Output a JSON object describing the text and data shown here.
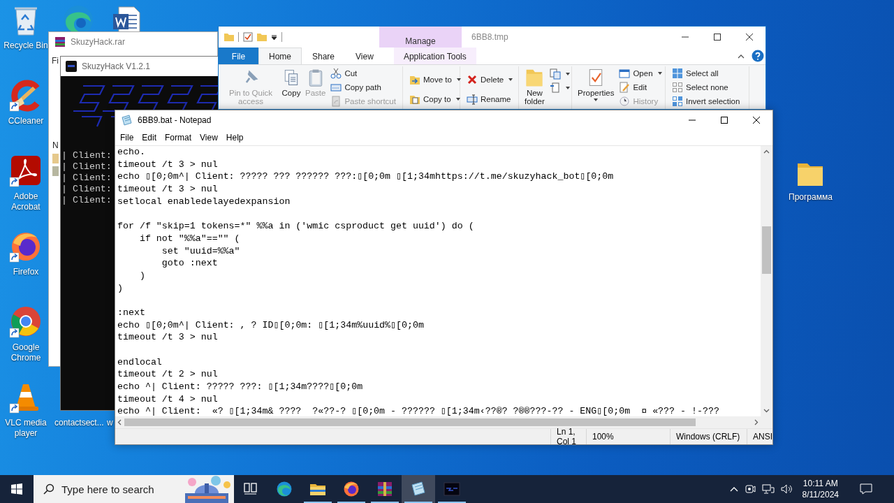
{
  "desktop": {
    "icons": [
      {
        "label": "Recycle Bin",
        "kind": "recycle",
        "shortcut": false
      },
      {
        "label": "CCleaner",
        "kind": "ccleaner",
        "shortcut": true
      },
      {
        "label": "Adobe Acrobat",
        "kind": "acrobat",
        "shortcut": true
      },
      {
        "label": "Firefox",
        "kind": "firefox",
        "shortcut": true
      },
      {
        "label": "Google Chrome",
        "kind": "chrome",
        "shortcut": true
      },
      {
        "label": "VLC media player",
        "kind": "vlc",
        "shortcut": true
      }
    ],
    "partial_icons": [
      {
        "kind": "edge"
      },
      {
        "kind": "word"
      }
    ],
    "partial_labels": [
      "contactsect...",
      "w"
    ],
    "folder": {
      "label": "Программа"
    }
  },
  "winrar": {
    "title": "SkuzyHack.rar",
    "menu_fragment": "Fi",
    "column_fragment": "N"
  },
  "console": {
    "title": "SkuzyHack V1.2.1",
    "lines": [
      "| Client:",
      "| Client:",
      "| Client:",
      "| Client:",
      "| Client:"
    ]
  },
  "explorer": {
    "title": "6BB8.tmp",
    "context_group": "Manage",
    "tabs": [
      {
        "label": "File",
        "kind": "file",
        "selected": false
      },
      {
        "label": "Home",
        "kind": "tab",
        "selected": true
      },
      {
        "label": "Share",
        "kind": "tab",
        "selected": false
      },
      {
        "label": "View",
        "kind": "tab",
        "selected": false
      },
      {
        "label": "Application Tools",
        "kind": "context",
        "selected": false
      }
    ],
    "ribbon": [
      {
        "large": [
          {
            "label": "Pin to Quick access",
            "disabled": true
          },
          {
            "label": "Copy",
            "disabled": false
          },
          {
            "label": "Paste",
            "disabled": true
          }
        ],
        "small": [
          {
            "label": "Cut",
            "disabled": false,
            "dropdown": false
          },
          {
            "label": "Copy path",
            "disabled": false,
            "dropdown": false
          },
          {
            "label": "Paste shortcut",
            "disabled": true,
            "dropdown": false
          }
        ]
      },
      {
        "small": [
          {
            "label": "Move to",
            "disabled": false,
            "dropdown": true
          },
          {
            "label": "Copy to",
            "disabled": false,
            "dropdown": true
          }
        ]
      },
      {
        "small": [
          {
            "label": "Delete",
            "disabled": false,
            "dropdown": true
          },
          {
            "label": "Rename",
            "disabled": false,
            "dropdown": false
          }
        ]
      },
      {
        "large": [
          {
            "label": "New folder",
            "disabled": false
          }
        ],
        "icon_buttons": [
          {
            "dropdown": true
          },
          {
            "dropdown": true
          }
        ]
      },
      {
        "large": [
          {
            "label": "Properties",
            "disabled": false,
            "dropdown": true
          }
        ],
        "small": [
          {
            "label": "Open",
            "disabled": false,
            "dropdown": true
          },
          {
            "label": "Edit",
            "disabled": false,
            "dropdown": false
          },
          {
            "label": "History",
            "disabled": true,
            "dropdown": false
          }
        ]
      },
      {
        "small": [
          {
            "label": "Select all",
            "disabled": false,
            "dropdown": false
          },
          {
            "label": "Select none",
            "disabled": false,
            "dropdown": false
          },
          {
            "label": "Invert selection",
            "disabled": false,
            "dropdown": false
          }
        ]
      }
    ]
  },
  "notepad": {
    "title": "6BB9.bat - Notepad",
    "menu": [
      "File",
      "Edit",
      "Format",
      "View",
      "Help"
    ],
    "lines": [
      {
        "kind": "code",
        "text": "echo."
      },
      {
        "kind": "code",
        "text": "timeout /t 3 > nul"
      },
      {
        "kind": "code",
        "text": "echo ▯[0;0m^| Client: ????? ??? ?????? ???:▯[0;0m ▯[1;34mhttps://t.me/skuzyhack_bot▯[0;0m"
      },
      {
        "kind": "code",
        "text": "timeout /t 3 > nul"
      },
      {
        "kind": "code",
        "text": "setlocal enabledelayedexpansion"
      },
      {
        "kind": "blank"
      },
      {
        "kind": "code",
        "text": "for /f \"skip=1 tokens=*\" %%a in ('wmic csproduct get uuid') do ("
      },
      {
        "kind": "code",
        "text": "    if not \"%%a\"==\"\" ("
      },
      {
        "kind": "code",
        "text": "        set \"uuid=%%a\""
      },
      {
        "kind": "code",
        "text": "        goto :next"
      },
      {
        "kind": "code",
        "text": "    )"
      },
      {
        "kind": "code",
        "text": ")"
      },
      {
        "kind": "blank"
      },
      {
        "kind": "code",
        "text": ":next"
      },
      {
        "kind": "code",
        "text": "echo ▯[0;0m^| Client: , ? ID▯[0;0m: ▯[1;34m%uuid%▯[0;0m"
      },
      {
        "kind": "code",
        "text": "timeout /t 3 > nul"
      },
      {
        "kind": "blank"
      },
      {
        "kind": "code",
        "text": "endlocal"
      },
      {
        "kind": "code",
        "text": "timeout /t 2 > nul"
      },
      {
        "kind": "code",
        "text": "echo ^| Client: ????? ???: ▯[1;34m????▯[0;0m"
      },
      {
        "kind": "code",
        "text": "timeout /t 4 > nul"
      },
      {
        "kind": "code",
        "text": "echo ^| Client:  «? ▯[1;34m& ????  ?«??-? ▯[0;0m - ?????? ▯[1;34m‹??®? ?®®???-?? - ENG▯[0;0m  ¤ «??? - !-???"
      }
    ],
    "status": [
      "Ln 1, Col 1",
      "100%",
      "Windows (CRLF)",
      "ANSI"
    ]
  },
  "taskbar": {
    "search": {
      "placeholder": "Type here to search"
    },
    "apps": [
      {
        "kind": "taskview",
        "running": false,
        "selected": false
      },
      {
        "kind": "edge",
        "running": false,
        "selected": false
      },
      {
        "kind": "explorer",
        "running": true,
        "selected": false
      },
      {
        "kind": "firefox",
        "running": true,
        "selected": false
      },
      {
        "kind": "winrar",
        "running": true,
        "selected": false
      },
      {
        "kind": "notepad",
        "running": true,
        "selected": true
      },
      {
        "kind": "console",
        "running": true,
        "selected": false
      }
    ],
    "time": "10:11 AM",
    "date": "8/11/2024"
  }
}
